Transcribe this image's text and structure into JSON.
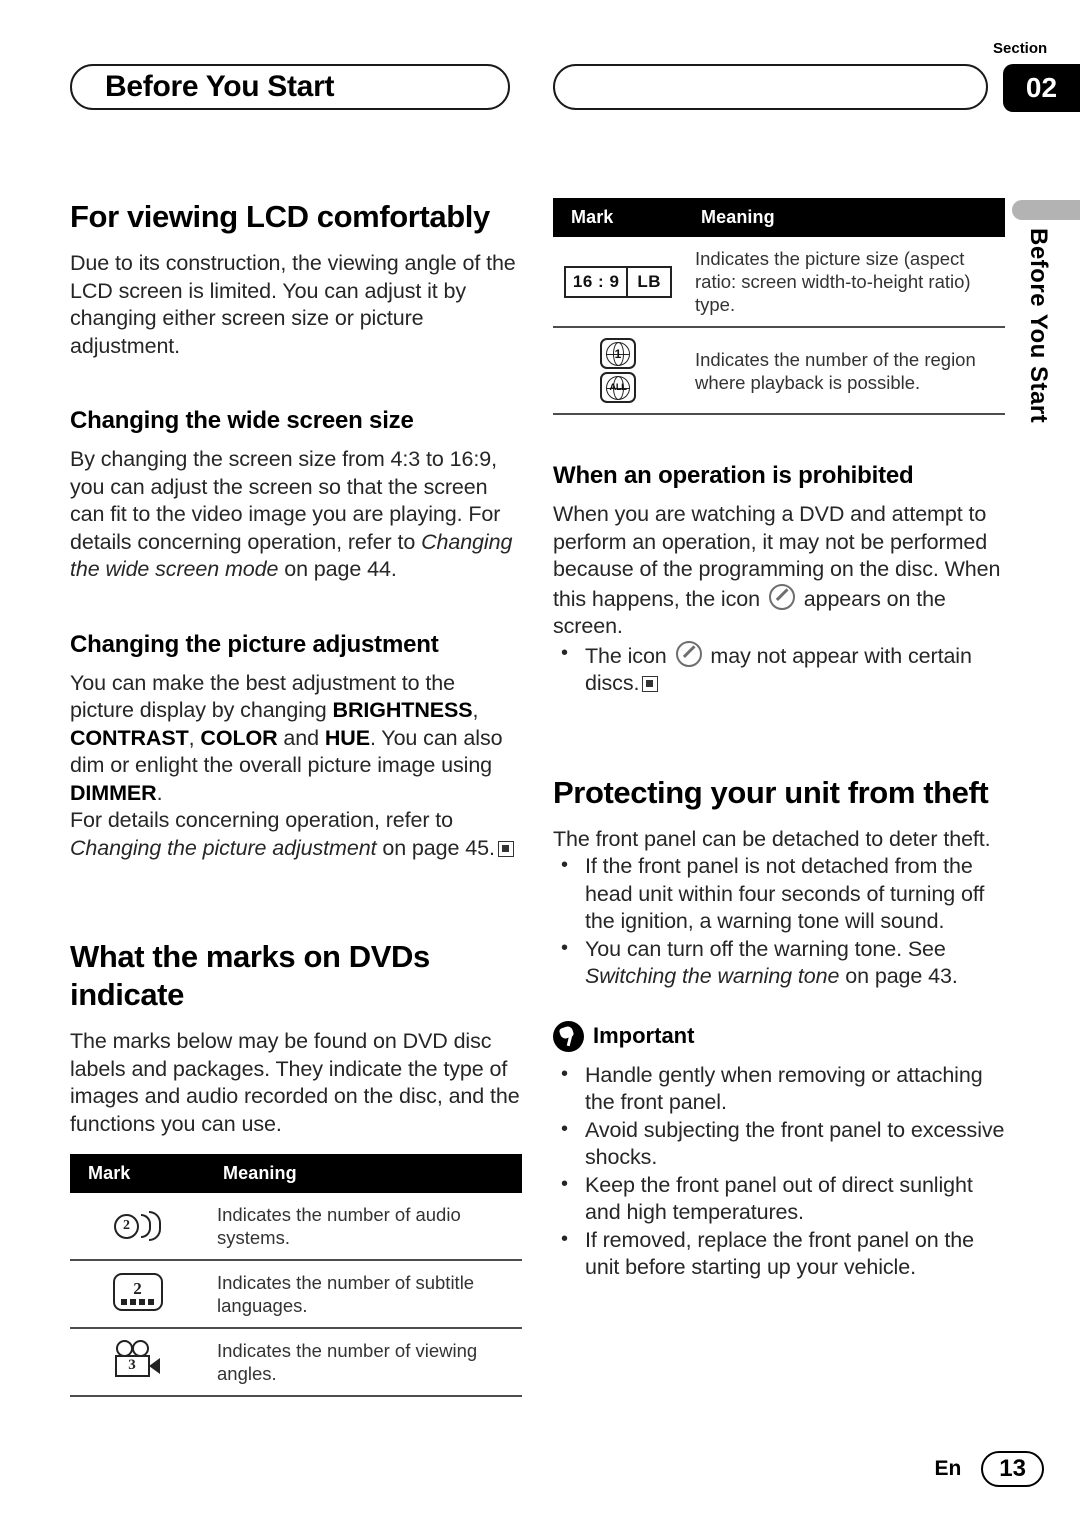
{
  "header": {
    "chapter_title": "Before You Start",
    "section_label": "Section",
    "section_number": "02"
  },
  "side_tab": {
    "label": "Before You Start"
  },
  "left_column": {
    "heading1": "For viewing LCD comfortably",
    "intro": "Due to its construction, the viewing angle of the LCD screen is limited. You can adjust it by changing either screen size or picture adjustment.",
    "sub1_heading": "Changing the wide screen size",
    "sub1_body_part1": "By changing the screen size from 4:3 to 16:9, you can adjust the screen so that the screen can fit to the video image you are playing. For details concerning operation, refer to ",
    "sub1_body_italic": "Changing the wide screen mode",
    "sub1_body_part2": " on page 44.",
    "sub2_heading": "Changing the picture adjustment",
    "sub2_body_part1": "You can make the best adjustment to the picture display by changing ",
    "sub2_kw1": "BRIGHTNESS",
    "sub2_body_part2": ", ",
    "sub2_kw2": "CONTRAST",
    "sub2_body_part3": ", ",
    "sub2_kw3": "COLOR",
    "sub2_body_part4": " and ",
    "sub2_kw4": "HUE",
    "sub2_body_part5": ". You can also dim or enlight the overall picture image using ",
    "sub2_kw5": "DIMMER",
    "sub2_body_part6": ".",
    "sub2_body2_part1": "For details concerning operation, refer to ",
    "sub2_body2_italic": "Changing the picture adjustment",
    "sub2_body2_part2": " on page 45.",
    "heading2": "What the marks on DVDs indicate",
    "marks_intro": "The marks below may be found on DVD disc labels and packages. They indicate the type of images and audio recorded on the disc, and the functions you can use.",
    "table": {
      "col_mark": "Mark",
      "col_meaning": "Meaning",
      "rows": [
        {
          "icon": "audio-systems-icon",
          "icon_value": "2",
          "meaning": "Indicates the number of audio systems."
        },
        {
          "icon": "subtitle-languages-icon",
          "icon_value": "2",
          "meaning": "Indicates the number of subtitle languages."
        },
        {
          "icon": "viewing-angles-icon",
          "icon_value": "3",
          "meaning": "Indicates the number of viewing angles."
        }
      ]
    }
  },
  "right_column": {
    "table": {
      "col_mark": "Mark",
      "col_meaning": "Meaning",
      "rows": [
        {
          "icon": "aspect-ratio-icon",
          "icon_value_a": "16 : 9",
          "icon_value_b": "LB",
          "meaning": "Indicates the picture size (aspect ratio: screen width-to-height ratio) type."
        },
        {
          "icon": "region-code-icon",
          "icon_value_a": "1",
          "icon_value_b": "ALL",
          "meaning": "Indicates the number of the region where playback is possible."
        }
      ]
    },
    "sub1_heading": "When an operation is prohibited",
    "sub1_body_part1": "When you are watching a DVD and attempt to perform an operation, it may not be performed because of the programming on the disc. When this happens, the icon ",
    "sub1_body_part2": " appears on the screen.",
    "sub1_bullet_part1": "The icon ",
    "sub1_bullet_part2": " may not appear with certain discs.",
    "heading2": "Protecting your unit from theft",
    "theft_intro": "The front panel can be detached to deter theft.",
    "theft_bullet1": "If the front panel is not detached from the head unit within four seconds of turning off the ignition, a warning tone will sound.",
    "theft_bullet2_part1": "You can turn off the warning tone. See ",
    "theft_bullet2_italic": "Switching the warning tone",
    "theft_bullet2_part2": " on page 43.",
    "important_label": "Important",
    "important_bullets": [
      "Handle gently when removing or attaching the front panel.",
      "Avoid subjecting the front panel to excessive shocks.",
      "Keep the front panel out of direct sunlight and high temperatures.",
      "If removed, replace the front panel on the unit before starting up your vehicle."
    ]
  },
  "footer": {
    "language": "En",
    "page_number": "13"
  },
  "colors": {
    "table_header_bg": "#000000",
    "side_tab_bar": "#b3b3b3",
    "text": "#262626"
  }
}
